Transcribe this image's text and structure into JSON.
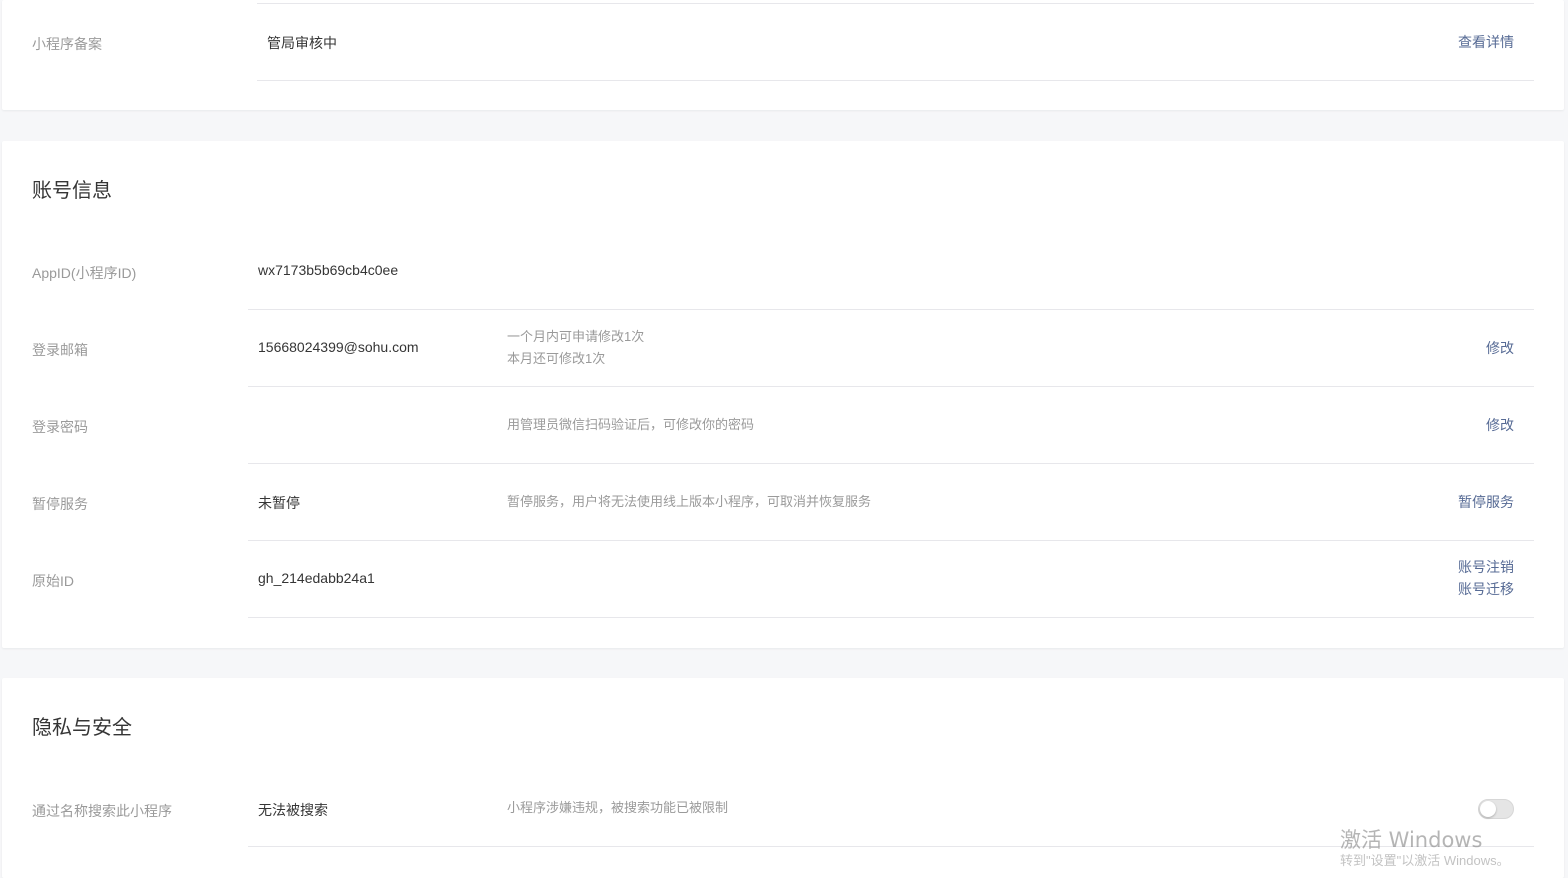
{
  "filing": {
    "label": "小程序备案",
    "value": "管局审核中",
    "action": "查看详情"
  },
  "account": {
    "title": "账号信息",
    "appid": {
      "label": "AppID(小程序ID)",
      "value": "wx7173b5b69cb4c0ee"
    },
    "email": {
      "label": "登录邮箱",
      "value": "15668024399@sohu.com",
      "tip_line1": "一个月内可申请修改1次",
      "tip_line2": "本月还可修改1次",
      "action": "修改"
    },
    "password": {
      "label": "登录密码",
      "tip": "用管理员微信扫码验证后，可修改你的密码",
      "action": "修改"
    },
    "suspend": {
      "label": "暂停服务",
      "value": "未暂停",
      "tip": "暂停服务，用户将无法使用线上版本小程序，可取消并恢复服务",
      "action": "暂停服务"
    },
    "original_id": {
      "label": "原始ID",
      "value": "gh_214edabb24a1",
      "action_cancel": "账号注销",
      "action_migrate": "账号迁移"
    }
  },
  "privacy": {
    "title": "隐私与安全",
    "search": {
      "label": "通过名称搜索此小程序",
      "value": "无法被搜索",
      "tip": "小程序涉嫌违规，被搜索功能已被限制",
      "toggle_on": false
    }
  },
  "watermark": {
    "line1": "激活 Windows",
    "line2": "转到\"设置\"以激活 Windows。"
  },
  "colors": {
    "link": "#576b95",
    "label": "#9a9a9a",
    "divider": "#e7e7eb",
    "background": "#f6f7f9"
  }
}
